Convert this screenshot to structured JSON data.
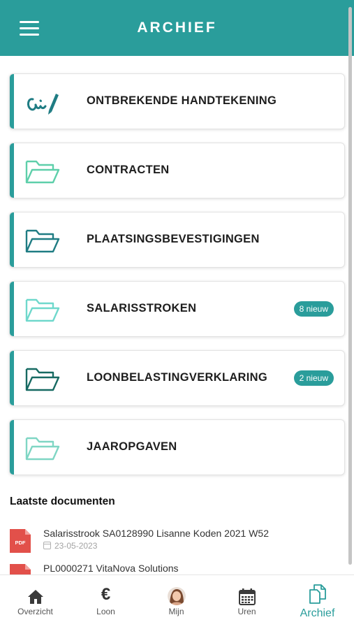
{
  "header": {
    "title": "ARCHIEF"
  },
  "cards": [
    {
      "label": "ONTBREKENDE HANDTEKENING",
      "icon": "signature-icon"
    },
    {
      "label": "CONTRACTEN",
      "icon": "folder-icon",
      "color": "#5ecfaa"
    },
    {
      "label": "PLAATSINGSBEVESTIGINGEN",
      "icon": "folder-icon",
      "color": "#1f7c83"
    },
    {
      "label": "SALARISSTROKEN",
      "icon": "folder-icon",
      "color": "#6fd8cc",
      "badge": "8 nieuw"
    },
    {
      "label": "LOONBELASTINGVERKLARING",
      "icon": "folder-icon",
      "color": "#176a62",
      "badge": "2 nieuw"
    },
    {
      "label": "JAAROPGAVEN",
      "icon": "folder-icon",
      "color": "#7fd6c4"
    }
  ],
  "recent": {
    "title": "Laatste documenten",
    "items": [
      {
        "title": "Salarisstrook SA0128990 Lisanne Koden 2021 W52",
        "date": "23-05-2023",
        "icon": "pdf-icon"
      },
      {
        "title": "PL0000271 VitaNova Solutions",
        "icon": "pdf-icon"
      }
    ]
  },
  "nav": [
    {
      "label": "Overzicht",
      "icon": "home-icon"
    },
    {
      "label": "Loon",
      "icon": "euro-icon",
      "glyph": "€"
    },
    {
      "label": "Mijn",
      "icon": "avatar"
    },
    {
      "label": "Uren",
      "icon": "calendar-icon"
    },
    {
      "label": "Archief",
      "icon": "documents-icon",
      "active": true
    }
  ],
  "colors": {
    "brand": "#2a9d9b",
    "pdf": "#e2504a"
  }
}
